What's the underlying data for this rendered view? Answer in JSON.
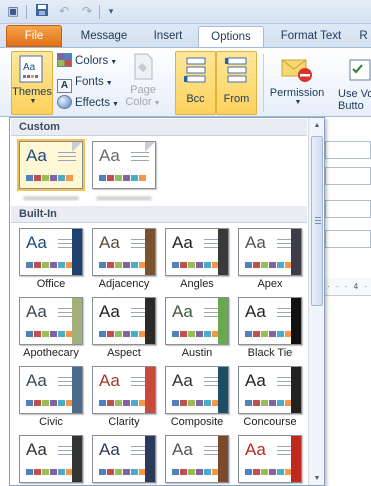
{
  "ribbon_tabs": [
    {
      "label": "File"
    },
    {
      "label": "Message"
    },
    {
      "label": "Insert"
    },
    {
      "label": "Options"
    },
    {
      "label": "Format Text"
    },
    {
      "label": "R"
    }
  ],
  "ribbon": {
    "themes_label": "Themes",
    "colors_label": "Colors",
    "fonts_label": "Fonts",
    "effects_label": "Effects",
    "page_color_label_1": "Page",
    "page_color_label_2": "Color",
    "bcc_label": "Bcc",
    "from_label": "From",
    "permission_label": "Permission",
    "use_voting_label_1": "Use Vo",
    "use_voting_label_2": "Butto"
  },
  "gallery": {
    "custom_header": "Custom",
    "builtin_header": "Built-In",
    "custom_themes": [
      {
        "name": "",
        "selected": true
      },
      {
        "name": "",
        "selected": false
      }
    ],
    "builtin_themes": [
      {
        "name": "Office",
        "accent": "#1f3f6e"
      },
      {
        "name": "Adjacency",
        "accent": "#7a5230"
      },
      {
        "name": "Angles",
        "accent": "#3a3a3a"
      },
      {
        "name": "Apex",
        "accent": "#3d3d4a"
      },
      {
        "name": "Apothecary",
        "accent": "#a3b07a"
      },
      {
        "name": "Aspect",
        "accent": "#2a2a2a"
      },
      {
        "name": "Austin",
        "accent": "#6aa84f"
      },
      {
        "name": "Black Tie",
        "accent": "#111111"
      },
      {
        "name": "Civic",
        "accent": "#4a6b8a"
      },
      {
        "name": "Clarity",
        "accent": "#c94a3a"
      },
      {
        "name": "Composite",
        "accent": "#1d4e66"
      },
      {
        "name": "Concourse",
        "accent": "#222222"
      },
      {
        "name": "",
        "accent": "#333333"
      },
      {
        "name": "",
        "accent": "#2a3a5a"
      },
      {
        "name": "",
        "accent": "#7a4a2a"
      },
      {
        "name": "",
        "accent": "#c0281e"
      }
    ]
  },
  "ruler_text": "· · · 4 ·"
}
